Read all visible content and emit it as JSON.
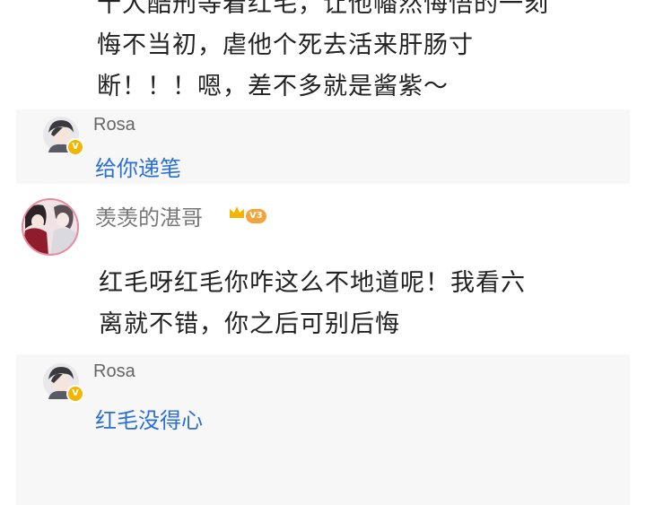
{
  "post": {
    "lines": [
      "十大酷刑等着红毛，让他幡然悔悟的一刻",
      "悔不当初，虐他个死去活来肝肠寸",
      "断！！！嗯，差不多就是酱紫～"
    ]
  },
  "replies": [
    {
      "name": "Rosa",
      "text": "给你递笔",
      "badge": "V"
    },
    {
      "name": "Rosa",
      "text": "红毛没得心",
      "badge": "V"
    }
  ],
  "comment": {
    "name": "羡羡的湛哥",
    "level": "V3",
    "lines": [
      "红毛呀红毛你咋这么不地道呢！我看六",
      "离就不错，你之后可别后悔"
    ]
  },
  "colors": {
    "link": "#2a6fd6",
    "reply_bg": "#f7f7f7",
    "badge": "#f5b400",
    "level": "#f3a33a"
  }
}
